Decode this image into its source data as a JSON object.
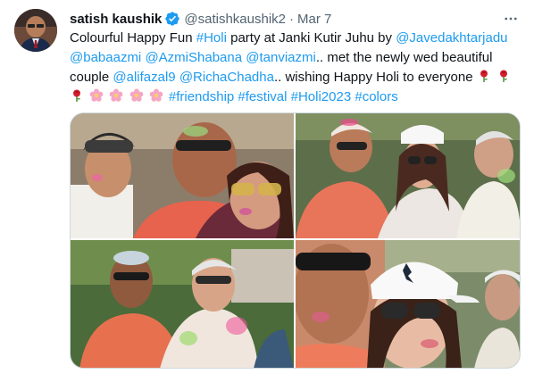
{
  "author": {
    "display_name": "satish kaushik",
    "handle": "@satishkaushik2",
    "separator": "·",
    "timestamp": "Mar 7",
    "verified": true,
    "verified_color": "#1d9bf0",
    "avatar_icon": "profile-photo"
  },
  "tweet": {
    "segments": [
      {
        "text": "Colourful Happy Fun ",
        "link": false
      },
      {
        "text": "#Holi",
        "link": true
      },
      {
        "text": " party at Janki Kutir Juhu by ",
        "link": false
      },
      {
        "text": "@Javedakhtarjadu",
        "link": true
      },
      {
        "text": " ",
        "link": false
      },
      {
        "text": "@babaazmi",
        "link": true
      },
      {
        "text": " ",
        "link": false
      },
      {
        "text": "@AzmiShabana",
        "link": true
      },
      {
        "text": " ",
        "link": false
      },
      {
        "text": "@tanviazmi",
        "link": true
      },
      {
        "text": ".. met the newly wed beautiful couple ",
        "link": false
      },
      {
        "text": "@alifazal9",
        "link": true
      },
      {
        "text": " ",
        "link": false
      },
      {
        "text": "@RichaChadha",
        "link": true
      },
      {
        "text": ".. wishing Happy Holi to everyone ",
        "link": false
      },
      {
        "emoji": "rose"
      },
      {
        "text": " ",
        "link": false
      },
      {
        "emoji": "rose"
      },
      {
        "text": " ",
        "link": false
      },
      {
        "emoji": "rose"
      },
      {
        "text": " ",
        "link": false
      },
      {
        "emoji": "blossom"
      },
      {
        "text": " ",
        "link": false
      },
      {
        "emoji": "blossom"
      },
      {
        "text": " ",
        "link": false
      },
      {
        "emoji": "blossom"
      },
      {
        "text": " ",
        "link": false
      },
      {
        "emoji": "blossom"
      },
      {
        "text": " ",
        "link": false
      },
      {
        "text": "#friendship",
        "link": true
      },
      {
        "text": " ",
        "link": false
      },
      {
        "text": "#festival",
        "link": true
      },
      {
        "text": " ",
        "link": false
      },
      {
        "text": "#Holi2023",
        "link": true
      },
      {
        "text": " ",
        "link": false
      },
      {
        "text": "#colors",
        "link": true
      }
    ]
  },
  "media": {
    "photos": [
      {
        "name": "holi-group-selfie-photo"
      },
      {
        "name": "holi-couple-photo"
      },
      {
        "name": "holi-two-men-photo"
      },
      {
        "name": "holi-closeup-selfie-photo"
      }
    ]
  },
  "colors": {
    "link": "#1d9bf0",
    "secondary_text": "#536471",
    "border": "#cfd9de"
  }
}
